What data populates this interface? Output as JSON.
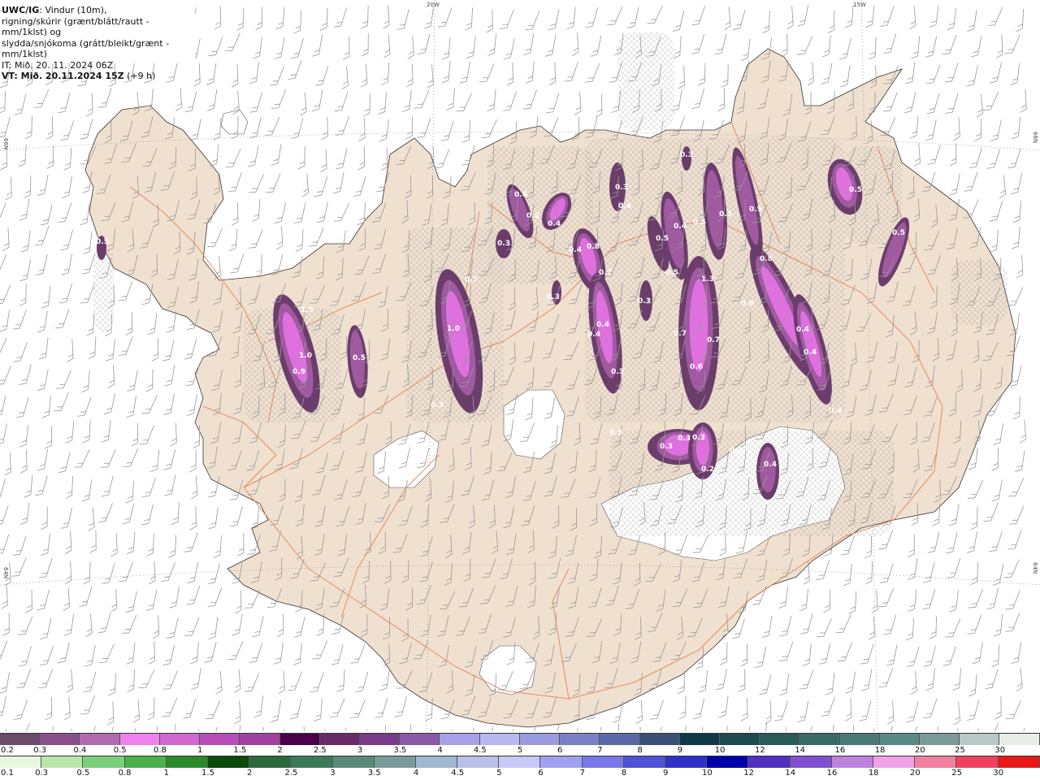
{
  "header": {
    "model": "UWC/IG",
    "description_line1": ": Vindur (10m),",
    "description_line2": "rigning/skúrir (grænt/blátt/rautt - mm/1klst) og",
    "description_line3": "slydda/snjókoma (grátt/bleikt/grænt - mm/1klst)",
    "init_time": "IT: Mið. 20. 11. 2024 06Z",
    "valid_time": "VT: Mið. 20.11.2024 15Z",
    "lead": "(+9 h)"
  },
  "graticule": {
    "lon_20w": "20W",
    "lon_15w": "15W",
    "lat_66n_left": "66N",
    "lat_66n_right": "66N",
    "lat_64n_left": "64N",
    "lat_64n_right": "64N"
  },
  "map_labels": [
    "0.5",
    "1.5",
    "1.0",
    "0.9",
    "0.5",
    "1.0",
    "0.7",
    "0.3",
    "0.4",
    "0.3",
    "0.4",
    "0.4",
    "0.3",
    "0.2",
    "0.8",
    "0.7",
    "0.4",
    "0.4",
    "0.3",
    "0.3",
    "0.4",
    "0.3",
    "0.5",
    "0.4",
    "0.3",
    "0.5",
    "0.3",
    "0.7",
    "0.6",
    "0.7",
    "1.3",
    "0.5",
    "0.9",
    "0.5",
    "0.8",
    "0.6",
    "0.4",
    "0.4",
    "0.4",
    "0.5",
    "0.5",
    "0.3",
    "0.3",
    "0.3",
    "0.2",
    "0.2",
    "0.4"
  ],
  "colors": {
    "ocean": "#ffffff",
    "land": "#f0e0d0",
    "roads": "#e87a4a",
    "ice": "#ffffff",
    "precip_dark": "#6b3d6b",
    "precip_mid": "#a05aa0",
    "precip_light": "#e070e0",
    "precip_bright": "#f090f0"
  },
  "legend_snow": {
    "labels": [
      "0.2",
      "0.3",
      "0.4",
      "0.5",
      "0.8",
      "1",
      "1.5",
      "2",
      "2.5",
      "3",
      "3.5",
      "4",
      "4.5",
      "5",
      "6",
      "7",
      "8",
      "9",
      "10",
      "12",
      "14",
      "16",
      "18",
      "20",
      "25",
      "30"
    ],
    "colors": [
      "#6b4a6b",
      "#8a4f8a",
      "#b06ab0",
      "#f080f0",
      "#d266d2",
      "#b84cb8",
      "#a040a0",
      "#4a004a",
      "#6a2a6a",
      "#7a3a8a",
      "#8a5aa8",
      "#a8a0e8",
      "#b8b8f0",
      "#9a9ae0",
      "#7a80c8",
      "#5a6aa8",
      "#3a5078",
      "#0e3a48",
      "#1e4a50",
      "#2a5a58",
      "#3a6a68",
      "#4a7a78",
      "#5a8a88",
      "#7a9a98",
      "#b8c8c8",
      "#e8ece8"
    ]
  },
  "legend_rain": {
    "labels": [
      "0.1",
      "0.3",
      "0.5",
      "0.8",
      "1",
      "1.5",
      "2",
      "2.5",
      "3",
      "3.5",
      "4",
      "4.5",
      "5",
      "6",
      "7",
      "8",
      "9",
      "10",
      "12",
      "14",
      "16",
      "18",
      "20",
      "25",
      "30"
    ],
    "colors": [
      "#e8f8e0",
      "#b8e8a8",
      "#7ad07a",
      "#4ab04a",
      "#2a8a2a",
      "#0a4a0a",
      "#2a6a3a",
      "#3a7a5a",
      "#5a8a7a",
      "#7a9a9a",
      "#a0b8d0",
      "#b8c0e8",
      "#c8c8f8",
      "#a0a0f0",
      "#7878e8",
      "#5050d8",
      "#3030c8",
      "#0000a8",
      "#5030c0",
      "#8050d0",
      "#c080e0",
      "#f0a0e8",
      "#f080a0",
      "#f04060",
      "#e81818"
    ]
  }
}
